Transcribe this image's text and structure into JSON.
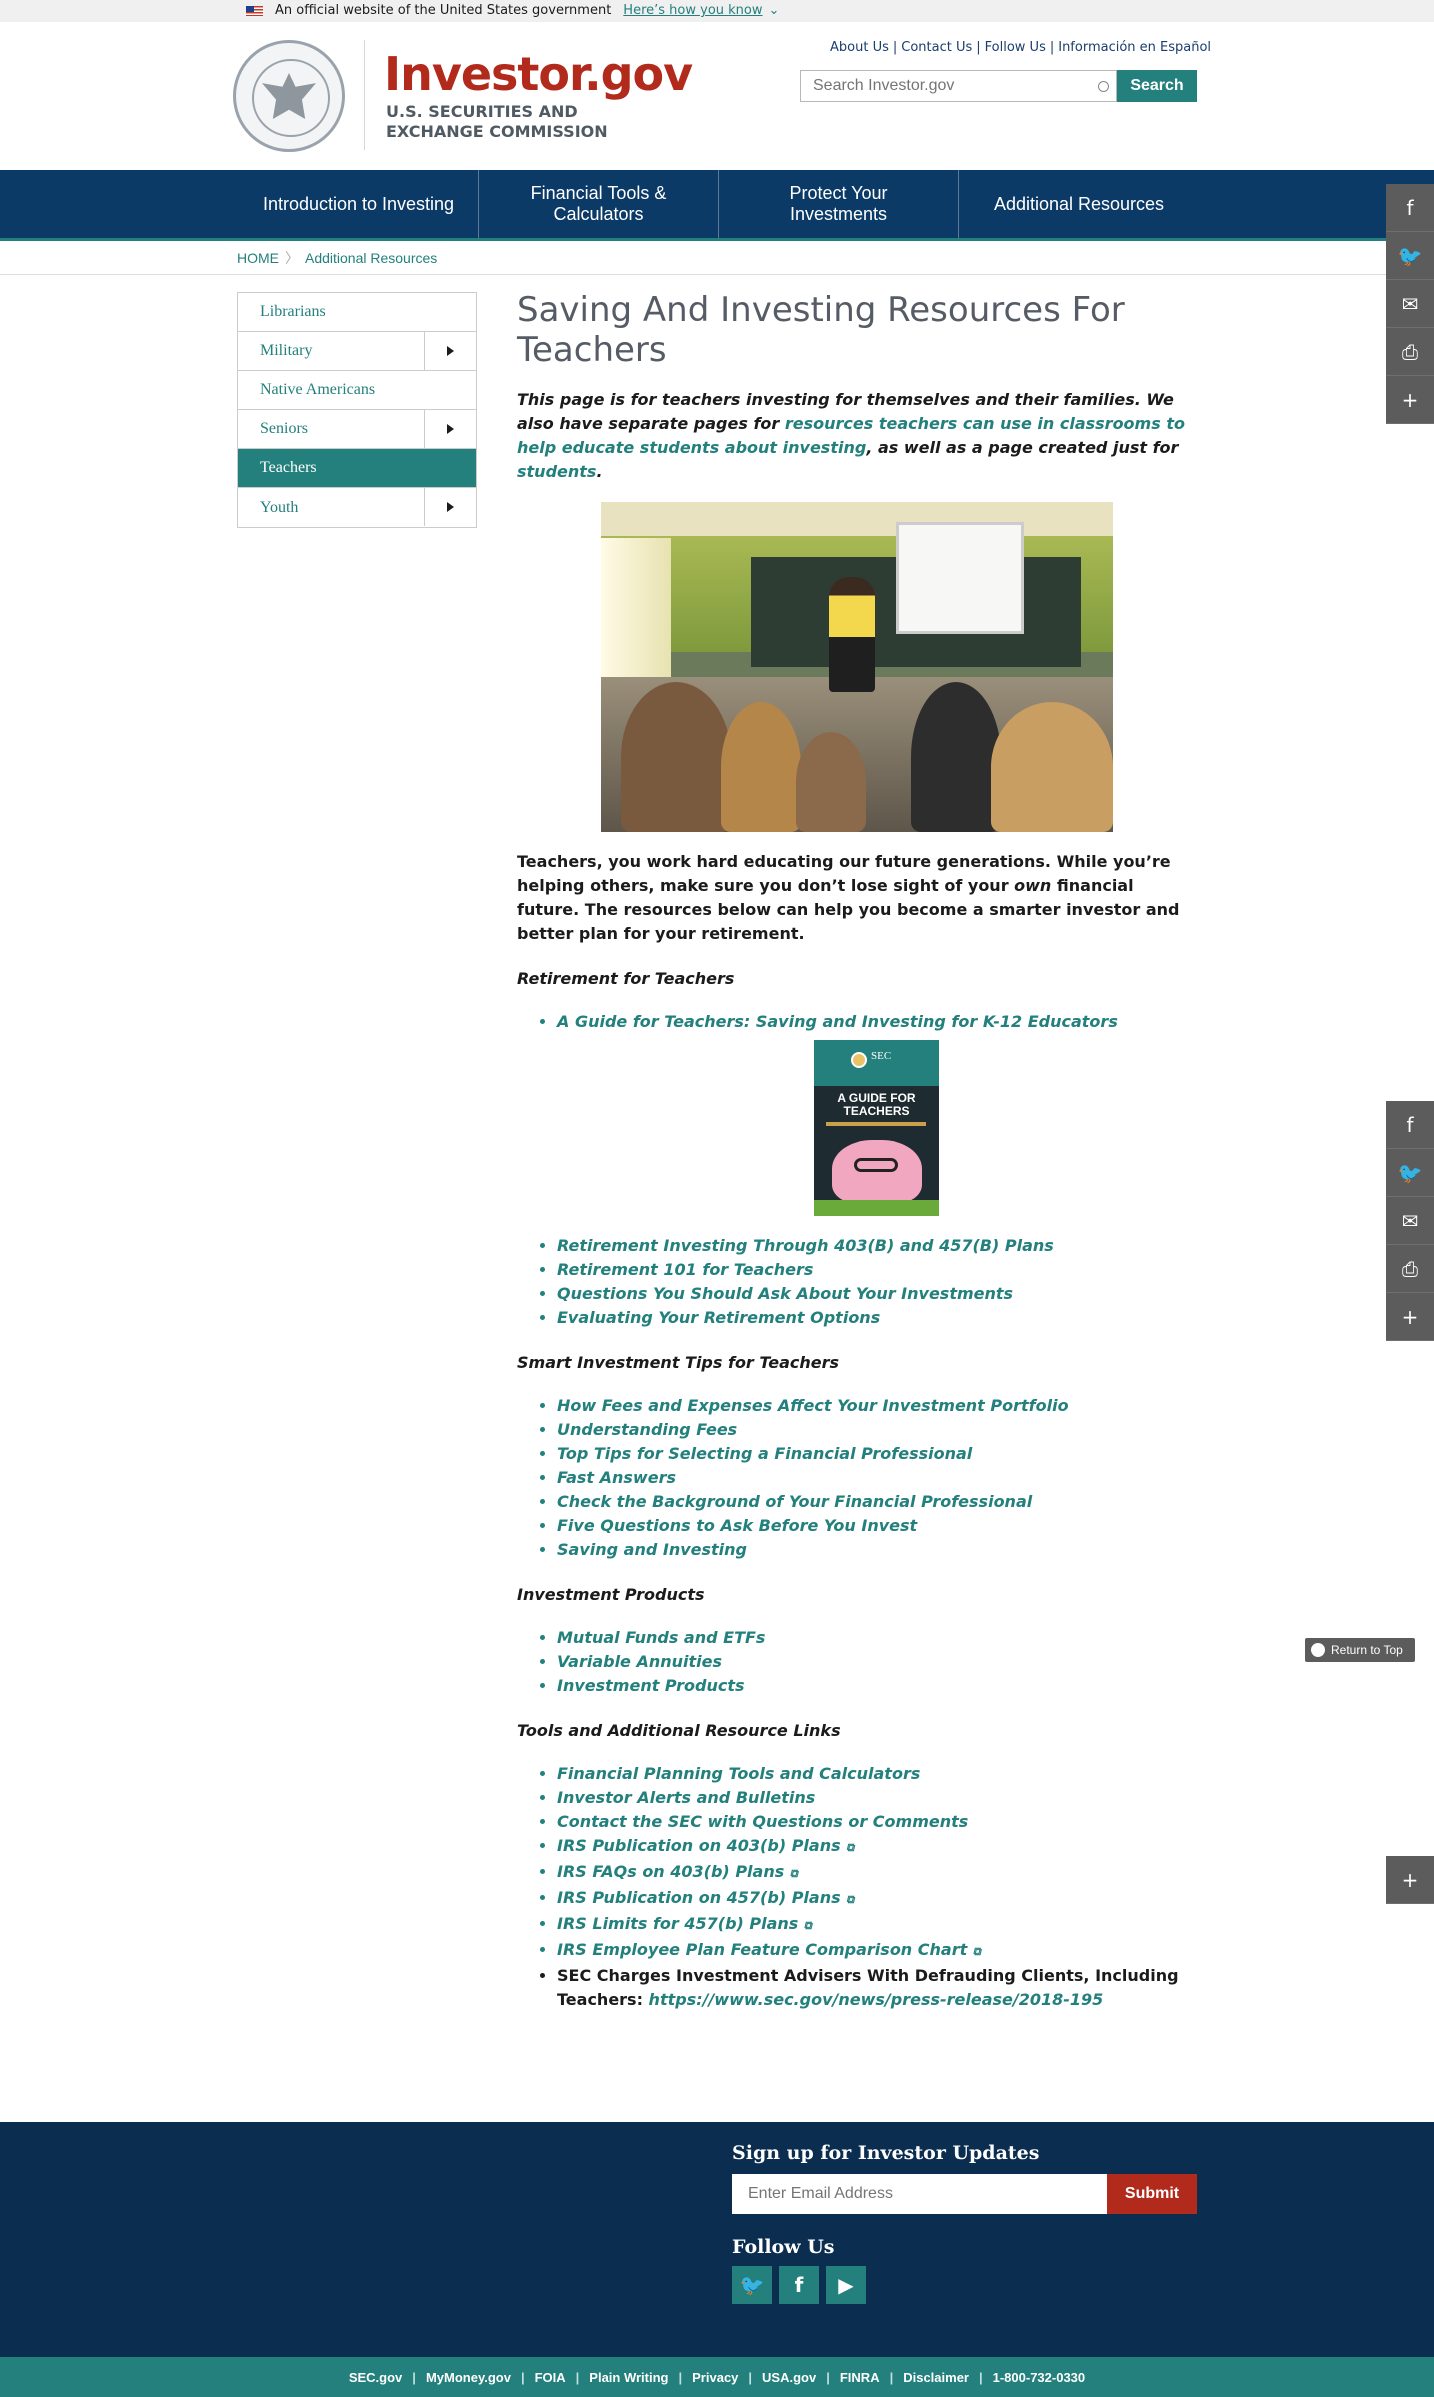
{
  "govbar": {
    "text": "An official website of the United States government",
    "link": "Here’s how you know"
  },
  "header": {
    "logo": "Investor.gov",
    "agency_line1": "U.S. SECURITIES AND",
    "agency_line2": "EXCHANGE COMMISSION",
    "toplinks": [
      "About Us",
      "Contact Us",
      "Follow Us",
      "Información en Español"
    ],
    "search_placeholder": "Search Investor.gov",
    "search_button": "Search"
  },
  "nav": [
    "Introduction to Investing",
    "Financial Tools & Calculators",
    "Protect Your Investments",
    "Additional Resources"
  ],
  "breadcrumb": {
    "home": "HOME",
    "current": "Additional Resources"
  },
  "sidebar": [
    {
      "label": "Librarians",
      "expand": false,
      "active": false
    },
    {
      "label": "Military",
      "expand": true,
      "active": false
    },
    {
      "label": "Native Americans",
      "expand": false,
      "active": false
    },
    {
      "label": "Seniors",
      "expand": true,
      "active": false
    },
    {
      "label": "Teachers",
      "expand": false,
      "active": true
    },
    {
      "label": "Youth",
      "expand": true,
      "active": false
    }
  ],
  "main": {
    "title": "Saving And Investing Resources For Teachers",
    "intro_a": "This page is for teachers investing for themselves and their families.  We also have separate pages for ",
    "intro_link1": "resources teachers can use in classrooms to help educate students about investing",
    "intro_b": ", as well as a page created just for ",
    "intro_link2": "students",
    "intro_c": ".",
    "p2_a": "Teachers, you work hard educating our future generations.  While you’re helping others, make sure you don’t lose sight of your ",
    "p2_em": "own",
    "p2_b": " financial future.  The resources below can help you become a smarter investor and better plan for your retirement.",
    "retirement": {
      "heading": "Retirement for Teachers",
      "first": "A Guide for Teachers: Saving and Investing for K-12 Educators",
      "cover": {
        "sec": "SEC",
        "title_line1": "A GUIDE FOR",
        "title_line2": "TEACHERS"
      },
      "items": [
        "Retirement Investing Through 403(B) and 457(B) Plans",
        "Retirement 101 for Teachers",
        "Questions You Should Ask About Your Investments",
        "Evaluating Your Retirement Options"
      ]
    },
    "smart": {
      "heading": "Smart Investment Tips for Teachers",
      "items": [
        "How Fees and Expenses Affect Your Investment Portfolio",
        "Understanding Fees",
        "Top Tips for Selecting a Financial Professional",
        "Fast Answers",
        "Check the Background of Your Financial Professional",
        "Five Questions to Ask Before You Invest",
        "Saving and Investing"
      ]
    },
    "products": {
      "heading": "Investment Products",
      "items": [
        "Mutual Funds and ETFs",
        "Variable Annuities",
        "Investment Products"
      ]
    },
    "tools": {
      "heading": "Tools and Additional Resource Links",
      "items": [
        "Financial Planning Tools and Calculators",
        "Investor Alerts and Bulletins",
        "Contact the SEC with Questions or Comments",
        "IRS Publication on 403(b) Plans",
        "IRS FAQs on 403(b) Plans",
        "IRS Publication on 457(b) Plans",
        "IRS Limits for 457(b) Plans",
        "IRS Employee Plan Feature Comparison Chart"
      ],
      "last_text": "SEC Charges Investment Advisers With Defrauding Clients, Including Teachers:  ",
      "last_link": "https://www.sec.gov/news/press-release/2018-195"
    }
  },
  "share_icons": [
    "facebook-icon",
    "twitter-icon",
    "email-icon",
    "print-icon",
    "plus-icon"
  ],
  "return_top": "Return to Top",
  "footer": {
    "signup": "Sign up for Investor Updates",
    "email_placeholder": "Enter Email Address",
    "submit": "Submit",
    "follow": "Follow Us",
    "links": [
      "SEC.gov",
      "MyMoney.gov",
      "FOIA",
      "Plain Writing",
      "Privacy",
      "USA.gov",
      "FINRA",
      "Disclaimer",
      "1-800-732-0330"
    ]
  }
}
